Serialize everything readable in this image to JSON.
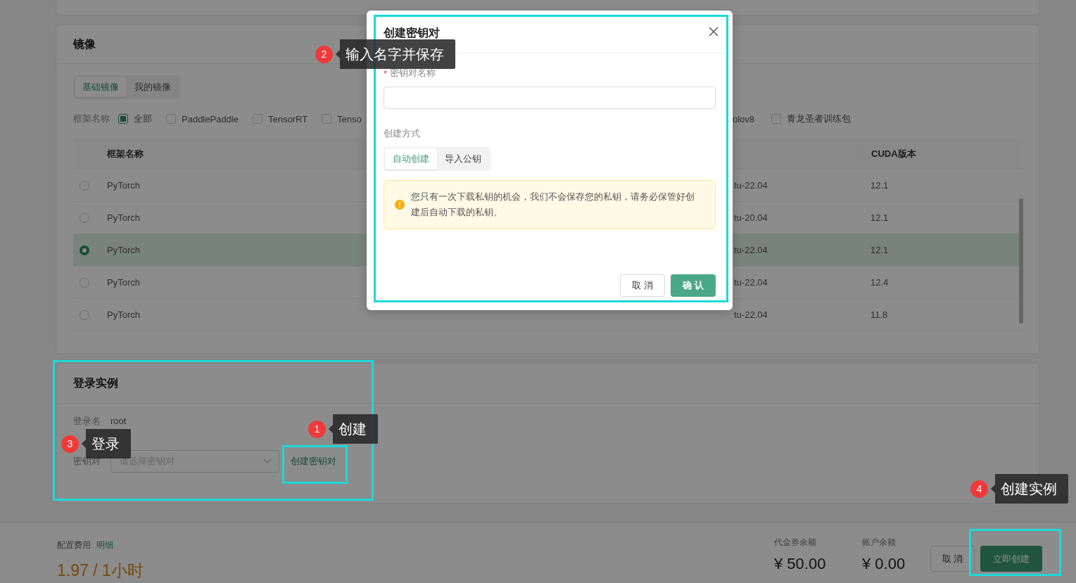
{
  "image_card": {
    "title": "镜像",
    "tabs": [
      {
        "label": "基础镜像",
        "selected": true
      },
      {
        "label": "我的镜像",
        "selected": false
      }
    ],
    "filter": {
      "label": "框架名称",
      "options": [
        {
          "label": "全部",
          "checked": true
        },
        {
          "label": "PaddlePaddle",
          "checked": false
        },
        {
          "label": "TensorRT",
          "checked": false
        },
        {
          "label": "Tenso",
          "checked": false
        }
      ],
      "cut_label": "olov8",
      "more_options": [
        {
          "label": "青龙圣者训练包",
          "checked": false
        }
      ]
    },
    "table": {
      "columns": [
        "框架名称",
        "CUDA版本"
      ],
      "rows": [
        {
          "selected": false,
          "framework": "PyTorch",
          "column_2": "tu-22.04",
          "cuda": "12.1"
        },
        {
          "selected": false,
          "framework": "PyTorch",
          "column_2": "tu-20.04",
          "cuda": "12.1"
        },
        {
          "selected": true,
          "framework": "PyTorch",
          "column_2": "tu-22.04",
          "cuda": "12.1"
        },
        {
          "selected": false,
          "framework": "PyTorch",
          "column_2": "tu-22.04",
          "cuda": "12.4"
        },
        {
          "selected": false,
          "framework": "PyTorch",
          "column_2": "tu-22.04",
          "cuda": "11.8"
        }
      ]
    }
  },
  "login_card": {
    "title": "登录实例",
    "login_name_label": "登录名",
    "login_name": "root",
    "keypair_label": "密钥对",
    "keypair_placeholder": "请选择密钥对",
    "create_link": "创建密钥对"
  },
  "footer": {
    "cost_label": "配置费用",
    "detail_link": "明细",
    "price": "1.97 / 1小时",
    "balances": [
      {
        "label": "代金券余额",
        "value": "¥ 50.00"
      },
      {
        "label": "账户余额",
        "value": "¥ 0.00"
      }
    ],
    "cancel": "取 消",
    "create": "立即创建"
  },
  "modal": {
    "title": "创建密钥对",
    "required_mark": "*",
    "name_label": "密钥对名称",
    "method_label": "创建方式",
    "methods": [
      {
        "label": "自动创建",
        "selected": true
      },
      {
        "label": "导入公钥",
        "selected": false
      }
    ],
    "warning": "您只有一次下载私钥的机会，我们不会保存您的私钥，请务必保管好创建后自动下载的私钥。",
    "cancel": "取 消",
    "confirm": "确 认"
  },
  "callouts": [
    {
      "number": "2",
      "text": "输入名字并保存"
    },
    {
      "number": "1",
      "text": "创建"
    },
    {
      "number": "3",
      "text": "登录"
    },
    {
      "number": "4",
      "text": "创建实例"
    }
  ]
}
